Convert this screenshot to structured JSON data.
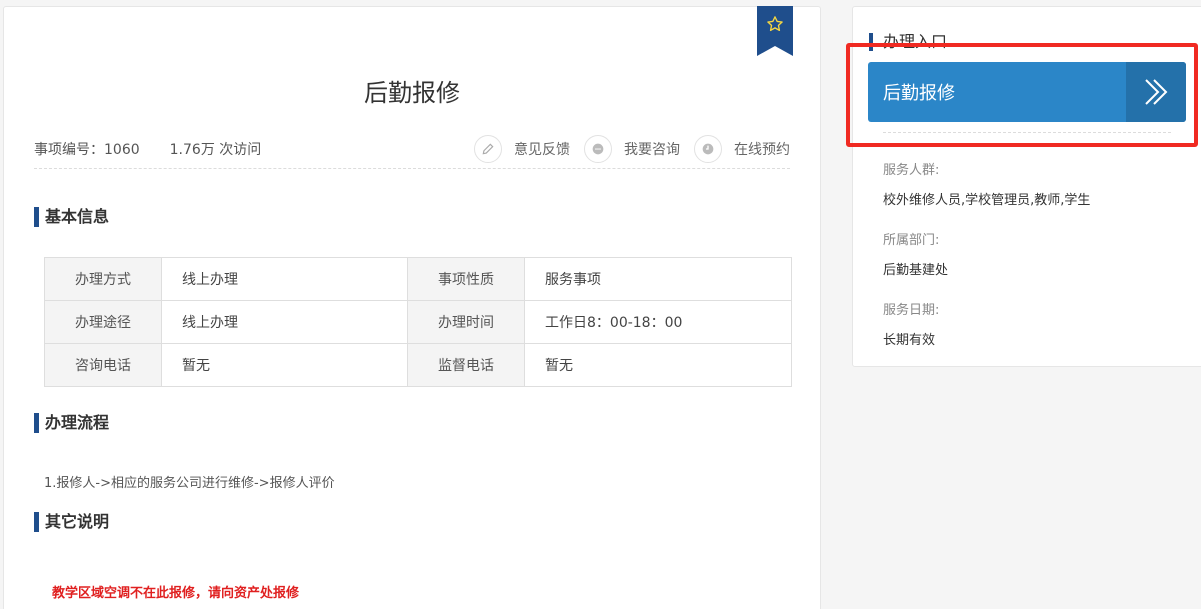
{
  "item": {
    "title": "后勤报修",
    "number_label": "事项编号：1060",
    "visits": "1.76万 次访问"
  },
  "actions": [
    {
      "label": "意见反馈",
      "icon": "pencil-icon"
    },
    {
      "label": "我要咨询",
      "icon": "chat-icon"
    },
    {
      "label": "在线预约",
      "icon": "clock-icon"
    }
  ],
  "sections": {
    "basic_info": "基本信息",
    "process": "办理流程",
    "other": "其它说明"
  },
  "basic_table": [
    [
      "办理方式",
      "线上办理",
      "事项性质",
      "服务事项"
    ],
    [
      "办理途径",
      "线上办理",
      "办理时间",
      "工作日8：00-18：00"
    ],
    [
      "咨询电话",
      "暂无",
      "监督电话",
      "暂无"
    ]
  ],
  "process_text": "1.报修人->相应的服务公司进行维修->报修人评价",
  "notice_text": "教学区域空调不在此报修，请向资产处报修",
  "sidebar": {
    "heading": "办理入口",
    "entry_button": "后勤报修",
    "audience_label": "服务人群:",
    "audience_value": "校外维修人员,学校管理员,教师,学生",
    "dept_label": "所属部门:",
    "dept_value": "后勤基建处",
    "date_label": "服务日期:",
    "date_value": "长期有效"
  },
  "colors": {
    "accent": "#1f4e8c",
    "button": "#2b86c8",
    "notice": "#e02020",
    "highlight": "#f02a22"
  }
}
